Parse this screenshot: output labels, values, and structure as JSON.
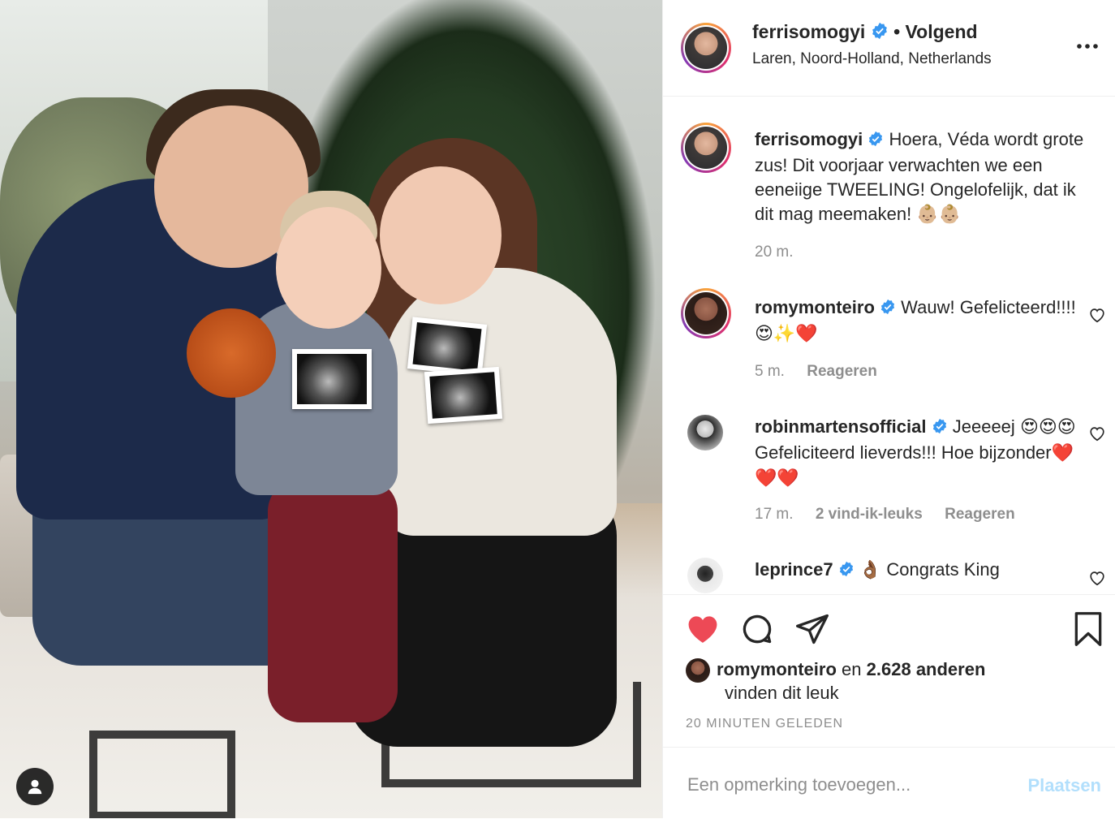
{
  "post": {
    "username": "ferrisomogyi",
    "follow_status": "• Volgend",
    "location": "Laren, Noord-Holland, Netherlands"
  },
  "caption": {
    "username": "ferrisomogyi",
    "text": "Hoera, Véda wordt grote zus! Dit voorjaar verwachten we een eeneiige TWEELING! Ongelofelijk, dat ik dit mag meemaken!",
    "emoji": "👶🏼👶🏼",
    "time": "20 m."
  },
  "comments": [
    {
      "username": "romymonteiro",
      "verified": true,
      "text": "Wauw! Gefelicteerd!!!!",
      "emoji": "😍✨❤️",
      "time": "5 m.",
      "likes": "",
      "reply_label": "Reageren"
    },
    {
      "username": "robinmartensofficial",
      "verified": true,
      "text_1": "Jeeeeej",
      "emoji_1": "😍😍😍",
      "text_2": "Gefeliciteerd lieverds!!! Hoe bijzonder",
      "emoji_2": "❤️❤️❤️",
      "time": "17 m.",
      "likes": "2 vind-ik-leuks",
      "reply_label": "Reageren"
    },
    {
      "username": "leprince7",
      "verified": true,
      "emoji_1": "👌🏾",
      "text": "Congrats King"
    }
  ],
  "likes": {
    "user": "romymonteiro",
    "connector": "en",
    "others": "2.628 anderen",
    "suffix": "vinden dit leuk"
  },
  "timestamp": "20 MINUTEN GELEDEN",
  "add_comment": {
    "placeholder": "Een opmerking toevoegen...",
    "post_label": "Plaatsen"
  },
  "colors": {
    "heart_liked": "#ed4956",
    "verified": "#3897f0",
    "post_button_disabled": "#b2dffc",
    "muted_text": "#8e8e8e"
  }
}
